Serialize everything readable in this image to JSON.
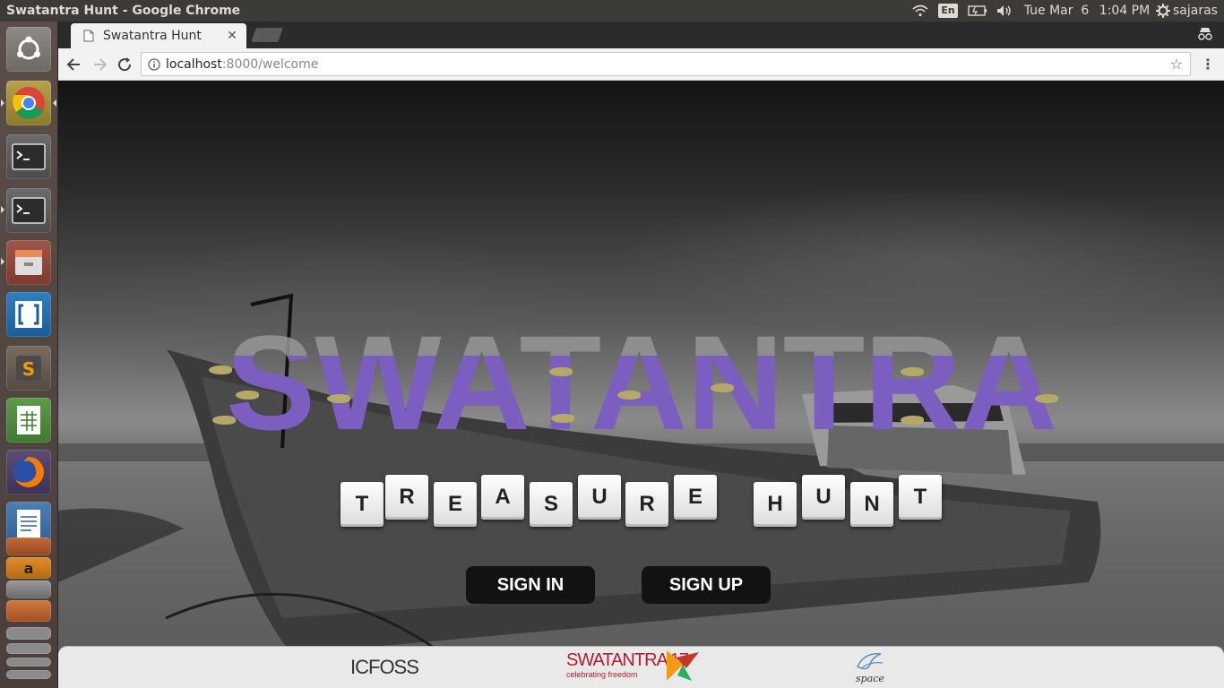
{
  "system": {
    "window_title": "Swatantra Hunt - Google Chrome",
    "keyboard_layout": "En",
    "date": "Tue Mar  6",
    "time": "1:04 PM",
    "user": "sajaras"
  },
  "launcher": {
    "items": [
      "ubuntu-dash-icon",
      "chrome-icon",
      "terminal-icon",
      "terminal-icon",
      "files-icon",
      "brackets-icon",
      "sublime-text-icon",
      "spreadsheet-icon",
      "firefox-icon",
      "writer-icon",
      "impress-icon",
      "amazon-icon",
      "text-editor-icon"
    ]
  },
  "browser": {
    "tab_title": "Swatantra Hunt",
    "url_host": "localhost",
    "url_rest": ":8000/welcome"
  },
  "page": {
    "title": "SWATANTRA",
    "subtitle_letters": [
      "T",
      "R",
      "E",
      "A",
      "S",
      "U",
      "R",
      "E",
      "H",
      "U",
      "N",
      "T"
    ],
    "sign_in": "SIGN IN",
    "sign_up": "SIGN UP",
    "footer_logos": {
      "icfoss": "ICFOSS",
      "swatantra": "SWATANTRA'17",
      "swatantra_tagline": "celebrating freedom",
      "space": "space"
    }
  },
  "colors": {
    "title_purple": "#7b5ec0",
    "fish_gold": "#b5a968",
    "button_bg": "#121212"
  }
}
